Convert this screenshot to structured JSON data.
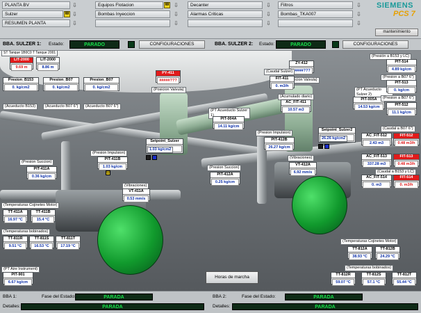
{
  "nav": {
    "col1": [
      "PLANTA BV",
      "Sulzer",
      "RESUMEN PLANTA"
    ],
    "col2": [
      "Equipos Flotacion",
      "Bombas Inyeccion",
      ""
    ],
    "col3": [
      "Decanter",
      "Alarmas Criticas",
      ""
    ],
    "col4": [
      "Filtros",
      "Bombas_TKA007",
      ""
    ],
    "warn_symbol": "W",
    "down_symbol": "⇩"
  },
  "brand": {
    "line1": "SIEMENS",
    "line2": "PCS 7"
  },
  "maintenance_label": "mantenimiento",
  "bba1": {
    "title": "BBA. SULZER 1:",
    "estado_label": "Estado:",
    "estado": "PARADO",
    "config": "CONFIGURACIONES"
  },
  "bba2": {
    "title": "BBA. SULZER 2:",
    "estado_label": "Estado:",
    "estado": "PARADO",
    "config": "CONFIGURACIONES"
  },
  "header_small": "ST Tanque 1B0C0 T Tanque 2001",
  "labels": {
    "acuedicto_b153": "(Acueducto B153)",
    "acuedicto_b07": "(Acueducto B07 6\")",
    "posicion_valvula1": "(Posicion Valvula)",
    "posicion_valvula2": "(Posicion Valvula)",
    "caudal_sulzer": "(Caudal Sulzer)",
    "acumulado_diario": "(Acumulado diario)",
    "pt_acueducto1": "(PT Acueducto Sulzer 1)",
    "pt_acueducto2": "(PT Acueducto Sulzer 2)",
    "presion_impulsion1": "(Presion Impulsion)",
    "presion_impulsion2": "(Presion Impulsion)",
    "presion_succion1": "(Presion Succion)",
    "presion_succion2": "(Presion Succion)",
    "vibraciones1": "(Vibraciones)",
    "vibraciones2": "(Vibraciones)",
    "temp_cojinetes1": "(Temperaturas Cojinetes Motor)",
    "temp_bobinados1": "(Temperaturas bobinados)",
    "temp_cojinetes2": "(Temperaturas Cojinetes Motor)",
    "temp_bobinados2": "(Temperaturas bobinados)",
    "pt_aire": "(PT Aire Instrument)",
    "presion_b153": "(Presión a B153 y LC)",
    "presion_b07": "(Presion a B07 6\")",
    "presion_b07b": "(Presion a B07 6\")",
    "caudal_b07": "(Caudal a B07 6\")",
    "caudal_b153": "(Caudal a B153 y LC)"
  },
  "tags": {
    "lit2000": {
      "name": "LIT-2000",
      "value": "9.69 m"
    },
    "lit2000b": {
      "name": "LIT-2000",
      "value": "8.86 m"
    },
    "r1": {
      "name": "Presion_B153",
      "value": "0. kg/cm2"
    },
    "r2": {
      "name": "Presion_B07",
      "value": "0. kg/cm2"
    },
    "r3": {
      "name": "Presion_B07",
      "value": "0. kg/cm2"
    },
    "py411": {
      "name": "PY-411",
      "value": "#####???"
    },
    "zy412": {
      "name": "ZY-412",
      "value": "#####???"
    },
    "fit411": {
      "name": "FIT-411",
      "value": "0. m3/h"
    },
    "acfit411": {
      "name": "AC_FIT-411",
      "value": "10.57 m3"
    },
    "pit004a": {
      "name": "PIT-004A",
      "value": "14.11 kg/cm"
    },
    "pit005a": {
      "name": "PIT-005A",
      "value": "14.53 kg/cm"
    },
    "sp1": {
      "name": "Setpoint_Sulzer",
      "value": "26.5"
    },
    "sp1b": {
      "name": "",
      "value": "1.03 kg/cm2"
    },
    "sp2": {
      "name": "Setpoint_Sulzer2",
      "value": "26.5"
    },
    "sp2b": {
      "name": "",
      "value": "26.26 kg/cm2"
    },
    "pit412b": {
      "name": "PIT-412B",
      "value": "26.27 kg/cm"
    },
    "pit411b": {
      "name": "PIT-411B",
      "value": "1.03 kg/cm"
    },
    "pit411a": {
      "name": "PIT-411A",
      "value": "0.36 kg/cm"
    },
    "pit412a": {
      "name": "PIT-412A",
      "value": "0.25 kg/cm"
    },
    "vt411a": {
      "name": "VT-411A",
      "value": "0.53 mm/s"
    },
    "vt412a": {
      "name": "VT-412A",
      "value": "6.92 mm/s"
    },
    "tt411a": {
      "name": "TT-411A",
      "value": "16.97 °C"
    },
    "tt411b": {
      "name": "TT-411B",
      "value": "15.4 °C"
    },
    "tt811r": {
      "name": "TT-811R",
      "value": "9.51 °C"
    },
    "tt811s": {
      "name": "TT-811S",
      "value": "16.53 °C"
    },
    "tt811t": {
      "name": "TT-811T",
      "value": "17.19 °C"
    },
    "pit901": {
      "name": "PIT-901",
      "value": "6.67 kg/cm"
    },
    "tt812a": {
      "name": "TT-812A",
      "value": "38.93 °C"
    },
    "tt812b": {
      "name": "TT-812B",
      "value": "24.29 °C"
    },
    "tt812r": {
      "name": "TT-812R",
      "value": "59.07 °C"
    },
    "tt812s": {
      "name": "TT-812S",
      "value": "57.1 °C"
    },
    "tt812t": {
      "name": "TT-812T",
      "value": "55.44 °C"
    },
    "pit514": {
      "name": "PIT-514",
      "value": "4.89 kg/cm"
    },
    "pit513": {
      "name": "PIT-513",
      "value": "0. kg/cm"
    },
    "pit512": {
      "name": "PIT-512",
      "value": "11.1 kg/cm"
    },
    "acfit512": {
      "name": "AC_FIT-512",
      "value": "2.43 m3"
    },
    "fit512": {
      "name": "FIT-512",
      "value": "0.48 m3/h"
    },
    "acfit513": {
      "name": "AC_FIT-513",
      "value": "337.28 m3"
    },
    "fit513": {
      "name": "FIT-513",
      "value": "0.48 m3/h"
    },
    "acfit514": {
      "name": "AC_FIT-514",
      "value": "0. m3"
    },
    "fit514": {
      "name": "FIT-514",
      "value": "0. m3/h"
    }
  },
  "horas_button": "Horas de marcha",
  "bottom": {
    "bba1_label": "BBA 1:",
    "fase_label": "Fase del Estado:",
    "fase1": "PARADA",
    "detalles_label": "Detalles:",
    "detalles1": "PARADA",
    "bba2_label": "BBA 2:",
    "fase2": "PARADA",
    "detalles2": "PARADA"
  }
}
